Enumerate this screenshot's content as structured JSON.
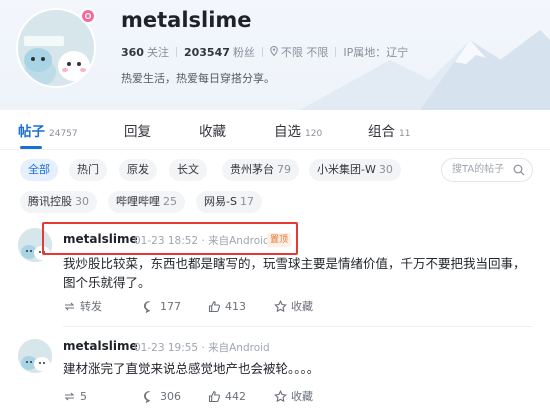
{
  "profile": {
    "username": "metalslime",
    "follow_count": "360",
    "follow_label": "关注",
    "fans_count": "203547",
    "fans_label": "粉丝",
    "location": "不限 不限",
    "ip_location": "IP属地：辽宁",
    "bio": "热爱生活，热爱每日穿搭分享。"
  },
  "tabs": [
    {
      "label": "帖子",
      "count": "24757",
      "active": true
    },
    {
      "label": "回复",
      "count": ""
    },
    {
      "label": "收藏",
      "count": ""
    },
    {
      "label": "自选",
      "count": "120"
    },
    {
      "label": "组合",
      "count": "11"
    }
  ],
  "filters": {
    "chips": [
      {
        "label": "全部",
        "count": ""
      },
      {
        "label": "热门",
        "count": ""
      },
      {
        "label": "原发",
        "count": ""
      },
      {
        "label": "长文",
        "count": ""
      },
      {
        "label": "贵州茅台",
        "count": "79"
      },
      {
        "label": "小米集团-W",
        "count": "30"
      },
      {
        "label": "腾讯控股",
        "count": "30"
      },
      {
        "label": "哔哩哔哩",
        "count": "25"
      },
      {
        "label": "网易-S",
        "count": "17"
      }
    ],
    "search_placeholder": "搜TA的帖子"
  },
  "posts": [
    {
      "author": "metalslime",
      "time": "01-23 18:52",
      "source": "· 来自Android",
      "pinned_label": "置顶",
      "text": "我炒股比较菜，东西也都是瞎写的，玩雪球主要是情绪价值，千万不要把我当回事，图个乐就得了。",
      "repost_label": "转发",
      "comments": "177",
      "likes": "413",
      "collect_label": "收藏"
    },
    {
      "author": "metalslime",
      "time": "01-23 19:55",
      "source": "· 来自Android",
      "text": "建材涨完了直觉来说总感觉地产也会被轮。。。。",
      "reposts": "5",
      "comments": "306",
      "likes": "442",
      "collect_label": "收藏"
    }
  ],
  "colors": {
    "accent": "#1a6fd6",
    "highlight": "#e53935",
    "pin": "#e8742a"
  }
}
